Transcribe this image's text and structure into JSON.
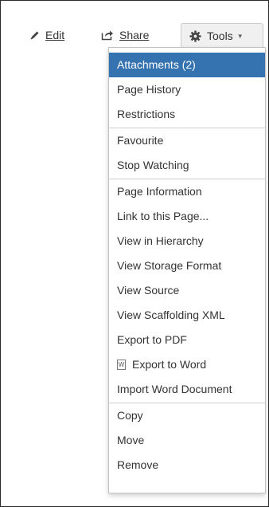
{
  "toolbar": {
    "edit_label": "Edit",
    "share_label": "Share",
    "tools_label": "Tools",
    "icons": {
      "edit": "pencil-icon",
      "share": "share-icon",
      "tools": "gear-icon",
      "caret": "chevron-down-icon"
    }
  },
  "menu": {
    "group1": [
      {
        "label": "Attachments (2)",
        "active": true
      },
      {
        "label": "Page History"
      },
      {
        "label": "Restrictions"
      }
    ],
    "group2": [
      {
        "label": "Favourite"
      },
      {
        "label": "Stop Watching"
      }
    ],
    "group3": [
      {
        "label": "Page Information"
      },
      {
        "label": "Link to this Page..."
      },
      {
        "label": "View in Hierarchy"
      },
      {
        "label": "View Storage Format"
      },
      {
        "label": "View Source"
      },
      {
        "label": "View Scaffolding XML"
      },
      {
        "label": "Export to PDF"
      },
      {
        "label": "Export to Word",
        "icon": "word-document-icon"
      },
      {
        "label": "Import Word Document"
      }
    ],
    "group4": [
      {
        "label": "Copy"
      },
      {
        "label": "Move"
      },
      {
        "label": "Remove"
      }
    ]
  },
  "colors": {
    "active_bg": "#3572b0",
    "active_text": "#ffffff",
    "text": "#333333"
  }
}
